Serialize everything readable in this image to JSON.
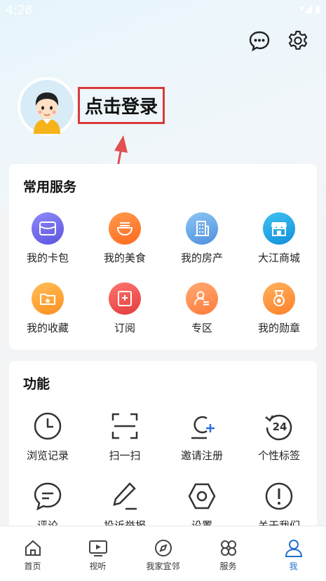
{
  "status_bar": {
    "time": "4:28",
    "icons": "▾◢ ▮"
  },
  "header": {
    "login_label": "点击登录",
    "icons": [
      "chat-icon",
      "gear-icon"
    ]
  },
  "services": {
    "title": "常用服务",
    "items": [
      {
        "label": "我的卡包",
        "icon": "wallet-icon",
        "color": "#6f6ae8"
      },
      {
        "label": "我的美食",
        "icon": "noodle-bowl-icon",
        "color": "#ff7a2f"
      },
      {
        "label": "我的房产",
        "icon": "building-icon",
        "color": "#62a7e8"
      },
      {
        "label": "大江商城",
        "icon": "store-icon",
        "color": "#20a6e3"
      },
      {
        "label": "我的收藏",
        "icon": "folder-star-icon",
        "color": "#ffa33a"
      },
      {
        "label": "订阅",
        "icon": "subscribe-icon",
        "color": "#ef4f4f"
      },
      {
        "label": "专区",
        "icon": "profile-card-icon",
        "color": "#ff8b4d"
      },
      {
        "label": "我的勋章",
        "icon": "medal-icon",
        "color": "#ff8f3c"
      }
    ]
  },
  "functions": {
    "title": "功能",
    "items": [
      {
        "label": "浏览记录",
        "icon": "clock-icon"
      },
      {
        "label": "扫一扫",
        "icon": "scan-icon"
      },
      {
        "label": "邀请注册",
        "icon": "invite-user-icon"
      },
      {
        "label": "个性标签",
        "icon": "refresh-24-icon",
        "badge": "24"
      },
      {
        "label": "评论",
        "icon": "comment-icon"
      },
      {
        "label": "投诉举报",
        "icon": "pencil-icon"
      },
      {
        "label": "设置",
        "icon": "hexagon-settings-icon"
      },
      {
        "label": "关于我们",
        "icon": "info-exclamation-icon"
      }
    ]
  },
  "bottom_nav": {
    "active_color": "#1f6fd1",
    "items": [
      {
        "label": "首页",
        "icon": "home-icon"
      },
      {
        "label": "视听",
        "icon": "tv-play-icon"
      },
      {
        "label": "我家宜邻",
        "icon": "compass-icon"
      },
      {
        "label": "服务",
        "icon": "grid-services-icon"
      },
      {
        "label": "我",
        "icon": "user-icon",
        "active": true
      }
    ]
  }
}
